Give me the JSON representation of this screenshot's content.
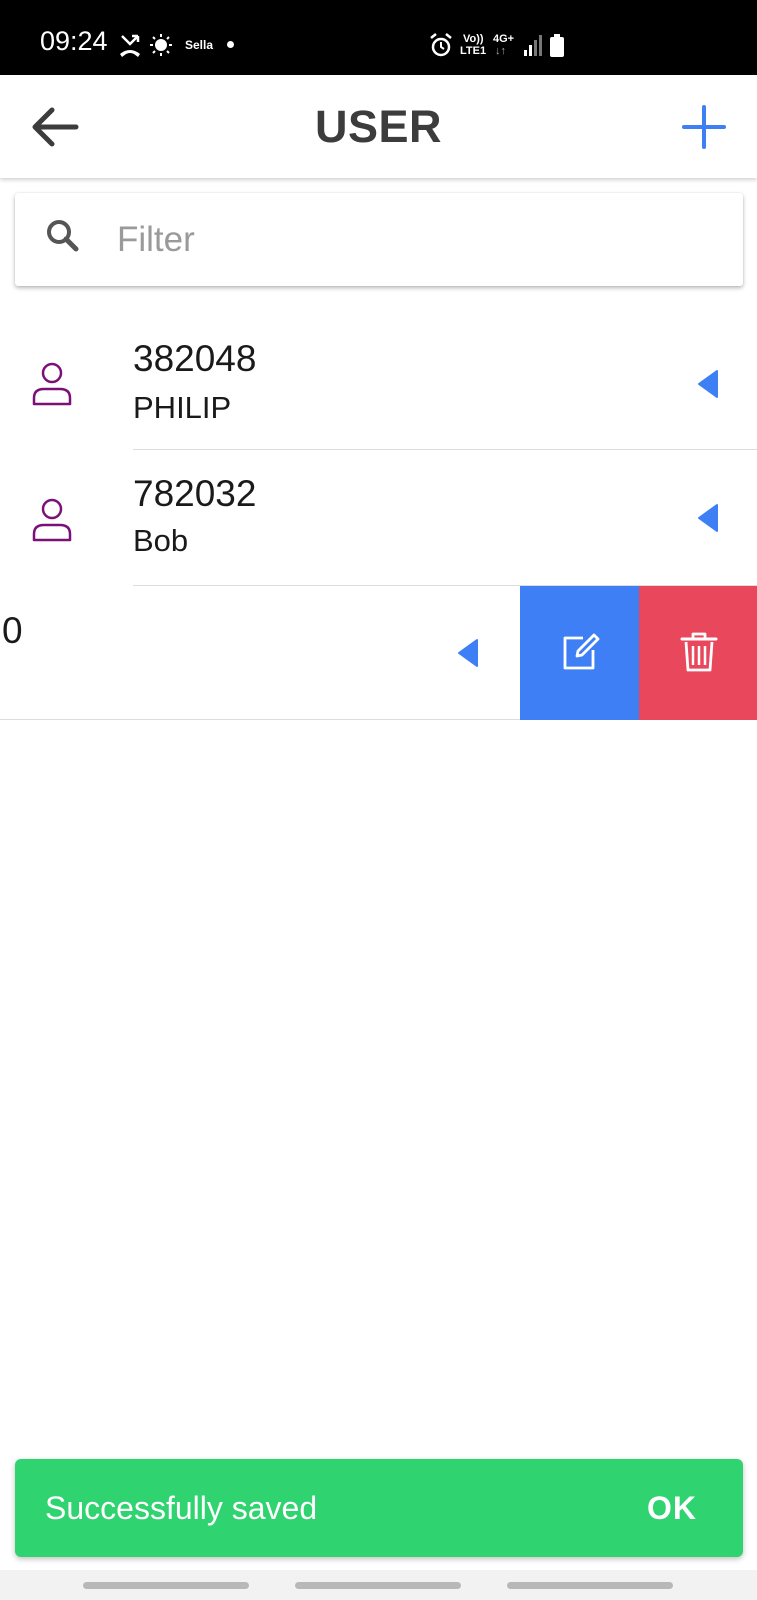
{
  "status_bar": {
    "time": "09:24",
    "carrier": "Sella",
    "net_top": "Vo))",
    "net_bottom": "LTE1",
    "net_type": "4G+",
    "icons": [
      "missed-call-icon",
      "brightness-icon",
      "notification-dot",
      "alarm-icon",
      "signal-icon",
      "battery-icon"
    ]
  },
  "header": {
    "title": "USER",
    "back_icon": "arrow-left-icon",
    "add_icon": "plus-icon"
  },
  "filter": {
    "placeholder": "Filter",
    "value": "",
    "icon": "search-icon"
  },
  "users": [
    {
      "id": "382048",
      "name": "PHILIP"
    },
    {
      "id": "782032",
      "name": "Bob"
    },
    {
      "id_visible_fragment": "0",
      "swiped_open": true
    }
  ],
  "row_actions": {
    "edit_icon": "edit-icon",
    "delete_icon": "trash-icon"
  },
  "snackbar": {
    "message": "Successfully saved",
    "action": "OK"
  },
  "colors": {
    "accent_blue": "#3e7ff5",
    "delete_red": "#e8475c",
    "success_green": "#2fd36f",
    "user_icon_purple": "#7b1178",
    "title_gray": "#3c3c3c"
  }
}
